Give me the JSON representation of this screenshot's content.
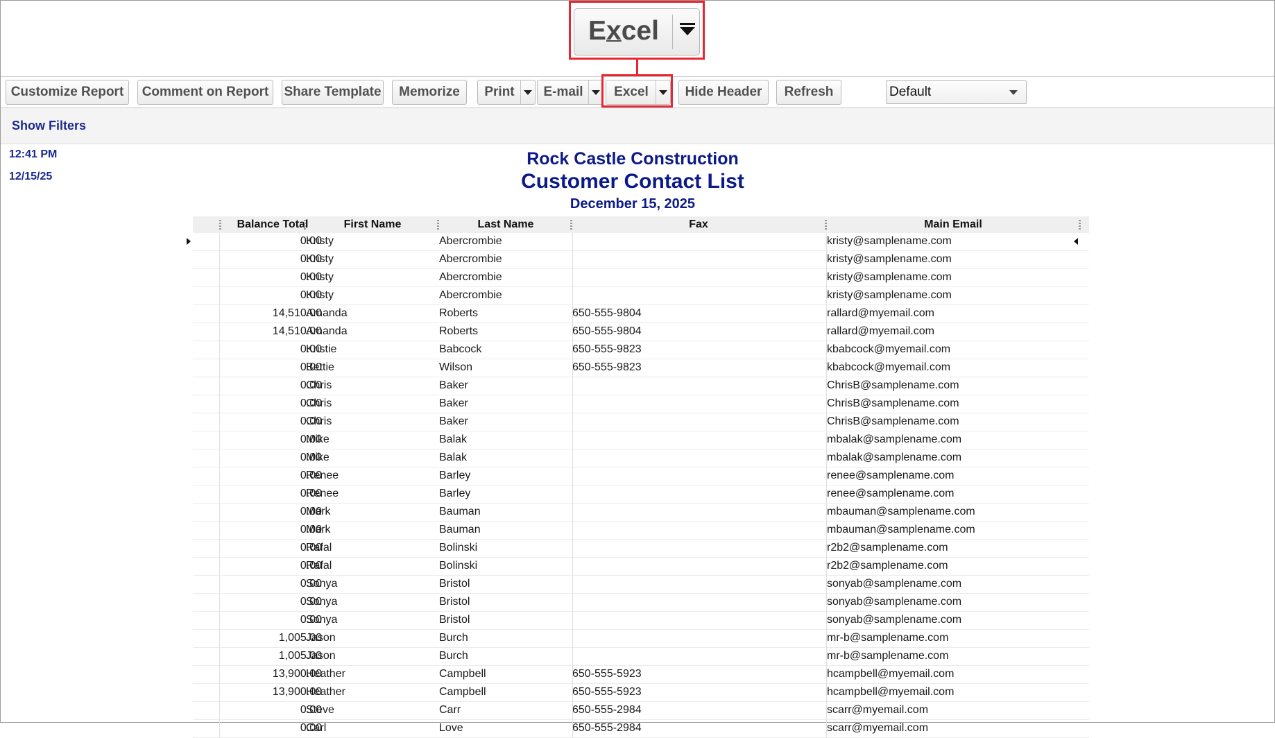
{
  "zoom_callout": {
    "label": "Excel",
    "underline_char": "x"
  },
  "toolbar": {
    "customize": "Customize Report",
    "comment": "Comment on Report",
    "share": "Share Template",
    "memorize": "Memorize",
    "print": "Print",
    "email": "E-mail",
    "excel": "Excel",
    "hide_header": "Hide Header",
    "refresh": "Refresh",
    "dropdown_value": "Default"
  },
  "filters": {
    "show_filters": "Show Filters"
  },
  "report": {
    "time": "12:41 PM",
    "date": "12/15/25",
    "company": "Rock Castle Construction",
    "title": "Customer Contact List",
    "as_of": "December 15, 2025",
    "columns": [
      "Balance Total",
      "First Name",
      "Last Name",
      "Fax",
      "Main Email"
    ],
    "rows": [
      [
        "0.00",
        "Kristy",
        "Abercrombie",
        "",
        "kristy@samplename.com"
      ],
      [
        "0.00",
        "Kristy",
        "Abercrombie",
        "",
        "kristy@samplename.com"
      ],
      [
        "0.00",
        "Kristy",
        "Abercrombie",
        "",
        "kristy@samplename.com"
      ],
      [
        "0.00",
        "Kristy",
        "Abercrombie",
        "",
        "kristy@samplename.com"
      ],
      [
        "14,510.00",
        "Amanda",
        "Roberts",
        "650-555-9804",
        "rallard@myemail.com"
      ],
      [
        "14,510.00",
        "Amanda",
        "Roberts",
        "650-555-9804",
        "rallard@myemail.com"
      ],
      [
        "0.00",
        "Kristie",
        "Babcock",
        "650-555-9823",
        "kbabcock@myemail.com"
      ],
      [
        "0.00",
        "Bettie",
        "Wilson",
        "650-555-9823",
        "kbabcock@myemail.com"
      ],
      [
        "0.00",
        "Chris",
        "Baker",
        "",
        "ChrisB@samplename.com"
      ],
      [
        "0.00",
        "Chris",
        "Baker",
        "",
        "ChrisB@samplename.com"
      ],
      [
        "0.00",
        "Chris",
        "Baker",
        "",
        "ChrisB@samplename.com"
      ],
      [
        "0.00",
        "Mike",
        "Balak",
        "",
        "mbalak@samplename.com"
      ],
      [
        "0.00",
        "Mike",
        "Balak",
        "",
        "mbalak@samplename.com"
      ],
      [
        "0.00",
        "Renee",
        "Barley",
        "",
        "renee@samplename.com"
      ],
      [
        "0.00",
        "Renee",
        "Barley",
        "",
        "renee@samplename.com"
      ],
      [
        "0.00",
        "Mark",
        "Bauman",
        "",
        "mbauman@samplename.com"
      ],
      [
        "0.00",
        "Mark",
        "Bauman",
        "",
        "mbauman@samplename.com"
      ],
      [
        "0.00",
        "Rafal",
        "Bolinski",
        "",
        "r2b2@samplename.com"
      ],
      [
        "0.00",
        "Rafal",
        "Bolinski",
        "",
        "r2b2@samplename.com"
      ],
      [
        "0.00",
        "Sonya",
        "Bristol",
        "",
        "sonyab@samplename.com"
      ],
      [
        "0.00",
        "Sonya",
        "Bristol",
        "",
        "sonyab@samplename.com"
      ],
      [
        "0.00",
        "Sonya",
        "Bristol",
        "",
        "sonyab@samplename.com"
      ],
      [
        "1,005.00",
        "Jason",
        "Burch",
        "",
        "mr-b@samplename.com"
      ],
      [
        "1,005.00",
        "Jason",
        "Burch",
        "",
        "mr-b@samplename.com"
      ],
      [
        "13,900.00",
        "Heather",
        "Campbell",
        "650-555-5923",
        "hcampbell@myemail.com"
      ],
      [
        "13,900.00",
        "Heather",
        "Campbell",
        "650-555-5923",
        "hcampbell@myemail.com"
      ],
      [
        "0.00",
        "Steve",
        "Carr",
        "650-555-2984",
        "scarr@myemail.com"
      ],
      [
        "0.00",
        "Carl",
        "Love",
        "650-555-2984",
        "scarr@myemail.com"
      ]
    ]
  }
}
